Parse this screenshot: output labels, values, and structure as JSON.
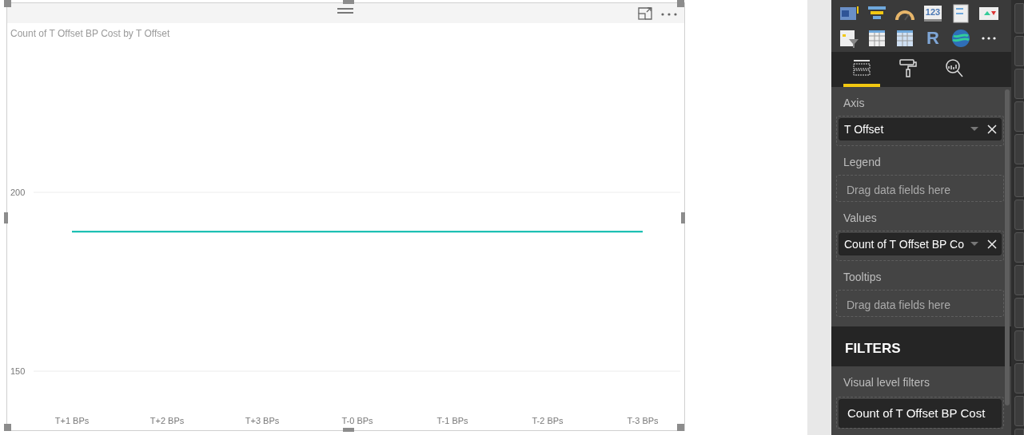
{
  "visual": {
    "chart_data": {
      "type": "line",
      "title": "Count of T Offset BP Cost by T Offset",
      "categories": [
        "T+1 BPs",
        "T+2 BPs",
        "T+3 BPs",
        "T-0 BPs",
        "T-1 BPs",
        "T-2 BPs",
        "T-3 BPs"
      ],
      "series": [
        {
          "color": "#01b8aa",
          "values": [
            189,
            189,
            189,
            189,
            189,
            189,
            189
          ]
        }
      ],
      "ylim": [
        150,
        200
      ],
      "yticks": [
        150,
        200
      ]
    }
  },
  "pane": {
    "visual_icons": [
      {
        "kind": "map"
      },
      {
        "kind": "funnel"
      },
      {
        "kind": "gauge"
      },
      {
        "kind": "card",
        "label": "123"
      },
      {
        "kind": "multirow"
      },
      {
        "kind": "kpi"
      },
      {
        "kind": "slicer"
      },
      {
        "kind": "table"
      },
      {
        "kind": "matrix"
      },
      {
        "kind": "r",
        "label": "R"
      },
      {
        "kind": "globe"
      },
      {
        "kind": "more"
      }
    ],
    "tabs": [
      {
        "kind": "fields",
        "selected": true
      },
      {
        "kind": "format",
        "selected": false
      },
      {
        "kind": "analytics",
        "selected": false
      }
    ],
    "wells": [
      {
        "label": "Axis",
        "field": "T Offset"
      },
      {
        "label": "Legend",
        "placeholder": "Drag data fields here"
      },
      {
        "label": "Values",
        "field": "Count of T Offset BP Co"
      },
      {
        "label": "Tooltips",
        "placeholder": "Drag data fields here"
      }
    ],
    "filters": {
      "title": "FILTERS",
      "section": "Visual level filters",
      "field": "Count of T Offset BP Cost"
    }
  }
}
